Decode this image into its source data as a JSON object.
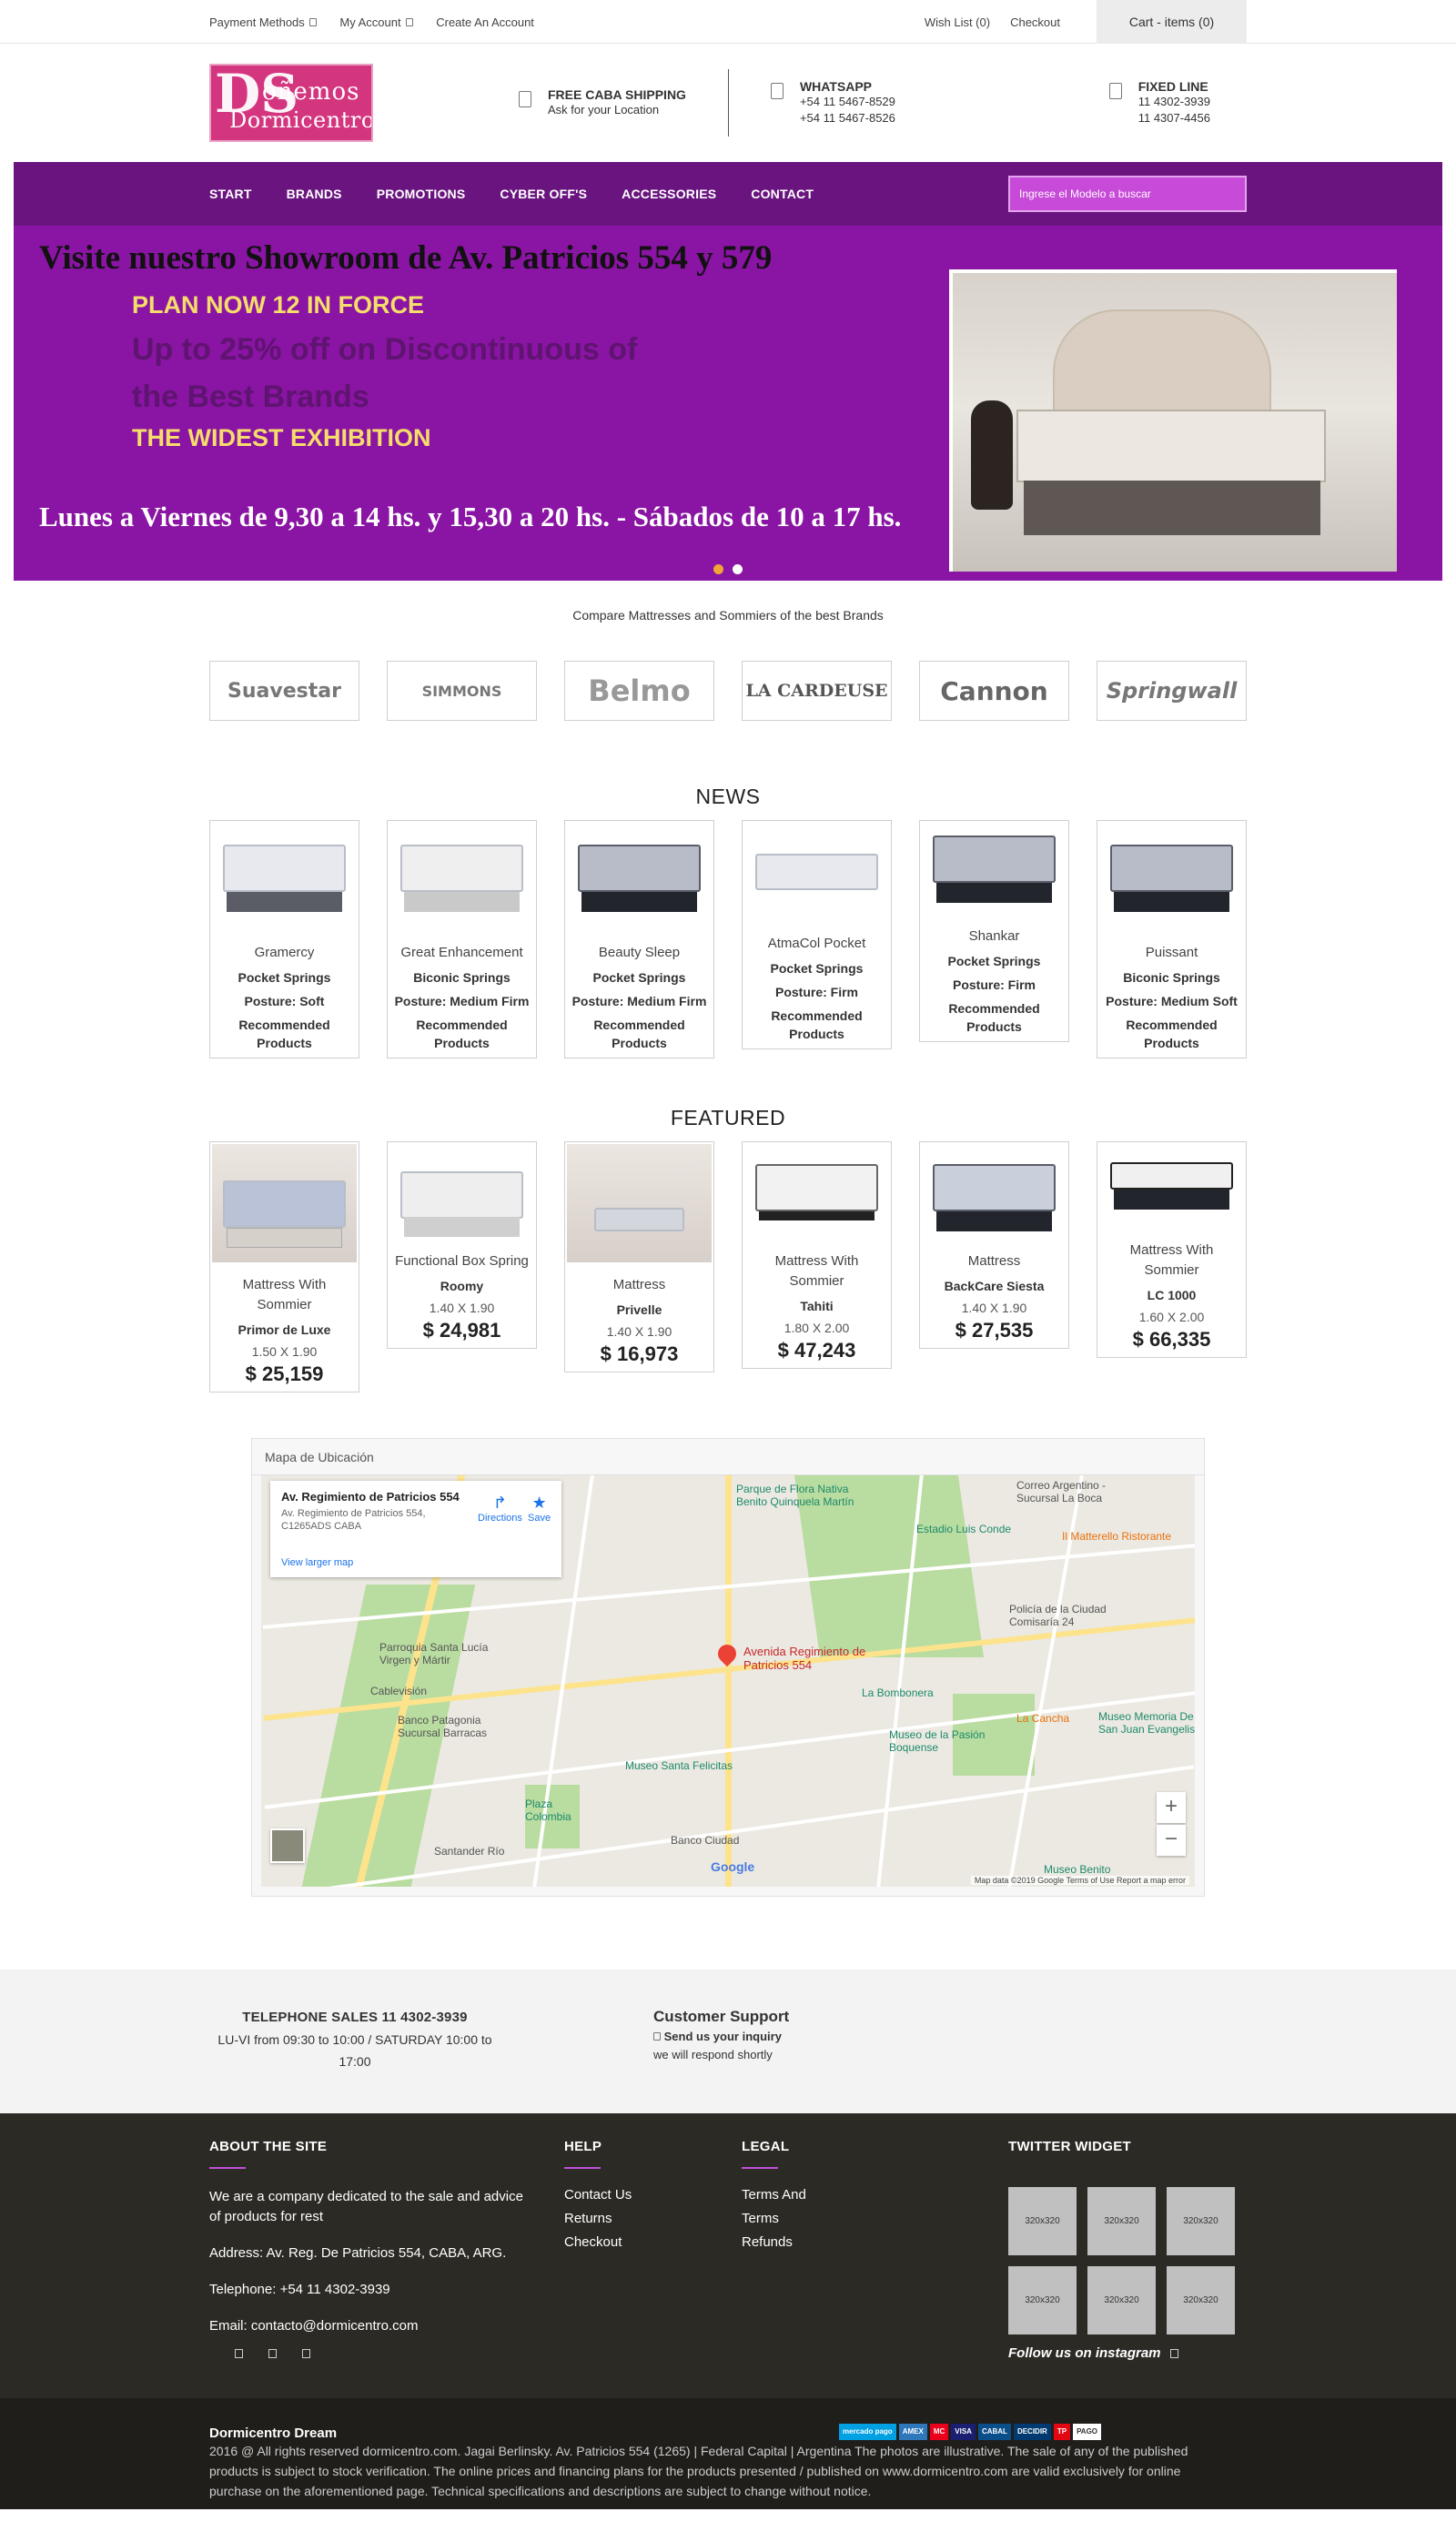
{
  "topbar": {
    "payment": "Payment Methods",
    "account": "My Account",
    "create": "Create An Account",
    "wishlist": "Wish List (0)",
    "checkout": "Checkout",
    "cart": "Cart - items (0)"
  },
  "logo": {
    "ds": "DS",
    "line1": "oñemos",
    "line2": "Dormicentro"
  },
  "header": {
    "shipping_title": "FREE CABA SHIPPING",
    "shipping_sub": "Ask for your Location",
    "whatsapp_title": "WHATSAPP",
    "whatsapp_1": "+54 11 5467-8529",
    "whatsapp_2": "+54 11 5467-8526",
    "fixed_title": "FIXED LINE",
    "fixed_1": "11 4302-3939",
    "fixed_2": "11 4307-4456"
  },
  "nav": {
    "items": [
      "START",
      "BRANDS",
      "PROMOTIONS",
      "CYBER OFF'S",
      "ACCESSORIES",
      "CONTACT"
    ],
    "search_placeholder": "Ingrese el Modelo a buscar"
  },
  "hero": {
    "title": "Visite nuestro Showroom de Av. Patricios 554 y 579",
    "line1": "PLAN NOW 12 IN FORCE",
    "line2": "Up to 25% off on Discontinuous of the Best Brands",
    "line3": "THE WIDEST EXHIBITION",
    "hours": "Lunes a Viernes de 9,30 a 14 hs. y 15,30 a 20 hs. - Sábados de 10 a 17 hs."
  },
  "brands": {
    "subtitle": "Compare Mattresses and Sommiers of the best Brands",
    "items": [
      "Suavestar",
      "SIMMONS",
      "Belmo",
      "LA CARDEUSE",
      "Cannon",
      "Springwall"
    ]
  },
  "news": {
    "title": "NEWS",
    "items": [
      {
        "name": "Gramercy",
        "l1": "Pocket Springs",
        "l2": "Posture: Soft",
        "l3": "Recommended Products"
      },
      {
        "name": "Great Enhancement",
        "l1": "Biconic Springs",
        "l2": "Posture: Medium Firm",
        "l3": "Recommended Products"
      },
      {
        "name": "Beauty Sleep",
        "l1": "Pocket Springs",
        "l2": "Posture: Medium Firm",
        "l3": "Recommended Products"
      },
      {
        "name": "AtmaCol Pocket",
        "l1": "Pocket Springs",
        "l2": "Posture: Firm",
        "l3": "Recommended Products"
      },
      {
        "name": "Shankar",
        "l1": "Pocket Springs",
        "l2": "Posture: Firm",
        "l3": "Recommended Products"
      },
      {
        "name": "Puissant",
        "l1": "Biconic Springs",
        "l2": "Posture: Medium Soft",
        "l3": "Recommended Products"
      }
    ]
  },
  "featured": {
    "title": "FEATURED",
    "items": [
      {
        "name": "Mattress With Sommier",
        "model": "Primor de Luxe",
        "size": "1.50 X 1.90",
        "price": "$ 25,159"
      },
      {
        "name": "Functional Box Spring",
        "model": "Roomy",
        "size": "1.40 X 1.90",
        "price": "$ 24,981"
      },
      {
        "name": "Mattress",
        "model": "Privelle",
        "size": "1.40 X 1.90",
        "price": "$ 16,973"
      },
      {
        "name": "Mattress With Sommier",
        "model": "Tahiti",
        "size": "1.80 X 2.00",
        "price": "$ 47,243"
      },
      {
        "name": "Mattress",
        "model": "BackCare Siesta",
        "size": "1.40 X 1.90",
        "price": "$ 27,535"
      },
      {
        "name": "Mattress With Sommier",
        "model": "LC 1000",
        "size": "1.60 X 2.00",
        "price": "$ 66,335"
      }
    ]
  },
  "map": {
    "header": "Mapa de Ubicación",
    "card_title": "Av. Regimiento de Patricios 554",
    "card_addr": "Av. Regimiento de Patricios 554, C1265ADS CABA",
    "directions": "Directions",
    "save": "Save",
    "larger": "View larger map",
    "pin_label": "Avenida Regimiento de Patricios 554",
    "places": [
      "Parque de Flora Nativa Benito Quinquela Martín",
      "Estadio Luis Conde",
      "Policía de la Ciudad Comisaría 24",
      "La Bombonera",
      "Museo de la Pasión Boquense",
      "Museo Santa Felicitas",
      "Banco Patagonia Sucursal Barracas",
      "Parroquia Santa Lucía Virgen y Mártir",
      "Plaza Colombia",
      "Santander Río",
      "Banco Ciudad",
      "La Cancha",
      "Museo Memoria De San Juan Evangelista",
      "Cablevisión",
      "Il Matterello Ristorante",
      "Correo Argentino - Sucursal La Boca",
      "Museo Benito"
    ],
    "footer": "Map data ©2019 Google   Terms of Use   Report a map error",
    "google": "Google"
  },
  "support": {
    "tel_title": "TELEPHONE SALES 11 4302-3939",
    "tel_hours": "LU-VI from 09:30 to 10:00 / SATURDAY 10:00 to 17:00",
    "cs_title": "Customer Support",
    "cs_line1": "Send us your inquiry",
    "cs_line2": "we will respond shortly"
  },
  "footer": {
    "about_title": "ABOUT THE SITE",
    "about_text": "We are a company dedicated to the sale and advice of products for rest",
    "address": "Address: Av. Reg. De Patricios 554, CABA, ARG.",
    "telephone": "Telephone: +54 11 4302-3939",
    "email": "Email: contacto@dormicentro.com",
    "help_title": "HELP",
    "help_links": [
      "Contact Us",
      "Returns",
      "Checkout"
    ],
    "legal_title": "LEGAL",
    "legal_links": [
      "Terms And",
      "Terms",
      "Refunds"
    ],
    "twitter_title": "TWITTER WIDGET",
    "tw_thumb": "320x320",
    "instagram": "Follow us on instagram"
  },
  "bottom": {
    "brand": "Dormicentro Dream",
    "text": "2016 @ All rights reserved dormicentro.com. Jagai Berlinsky. Av. Patricios 554 (1265) | Federal Capital | Argentina The photos are illustrative. The sale of any of the published products is subject to stock verification. The online prices and financing plans for the products presented / published on www.dormicentro.com are valid exclusively for online purchase on the aforementioned page. Technical specifications and descriptions are subject to change without notice.",
    "payments": [
      "mercado pago",
      "AMEX",
      "MC",
      "VISA",
      "CABAL",
      "DECIDIR",
      "TP",
      "PAGO"
    ]
  },
  "colors": {
    "nav": "#6a157f",
    "hero": "#8a14a3",
    "accent": "#c050d8",
    "footer": "#2b2a25"
  }
}
